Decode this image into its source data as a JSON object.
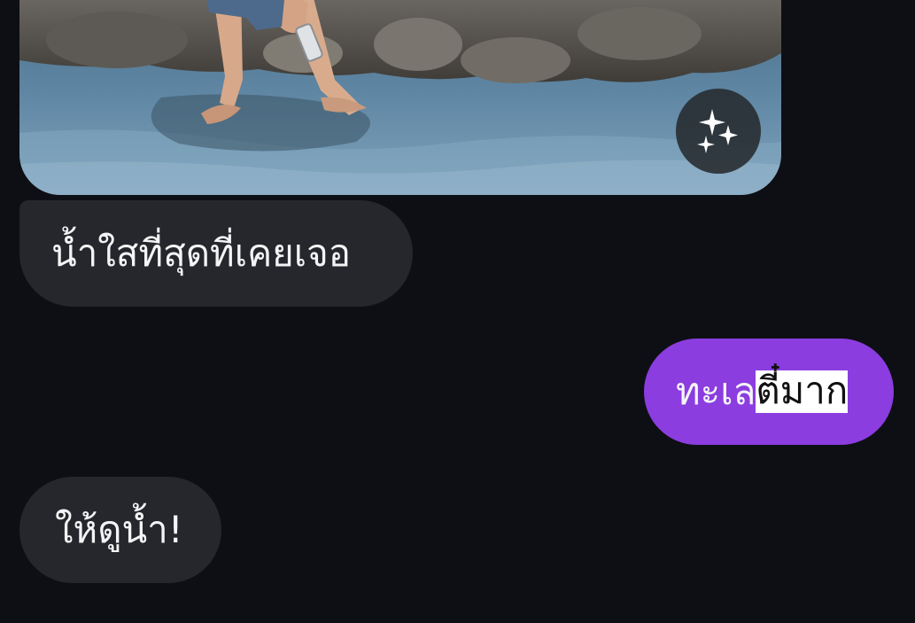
{
  "messages": [
    {
      "type": "image",
      "direction": "incoming",
      "description_icon": "sparkles-icon"
    },
    {
      "type": "text",
      "direction": "incoming",
      "text": "น้ำใสที่สุดที่เคยเจอ"
    },
    {
      "type": "text",
      "direction": "outgoing",
      "text_plain": "ทะเล",
      "text_selected": "ตี๋มาก"
    },
    {
      "type": "text",
      "direction": "incoming",
      "text": "ให้ดูน้ำ!"
    }
  ],
  "colors": {
    "background": "#0e0f14",
    "incoming_bubble": "#25272c",
    "outgoing_bubble": "#8b3de0",
    "selection": "#ffffff"
  }
}
